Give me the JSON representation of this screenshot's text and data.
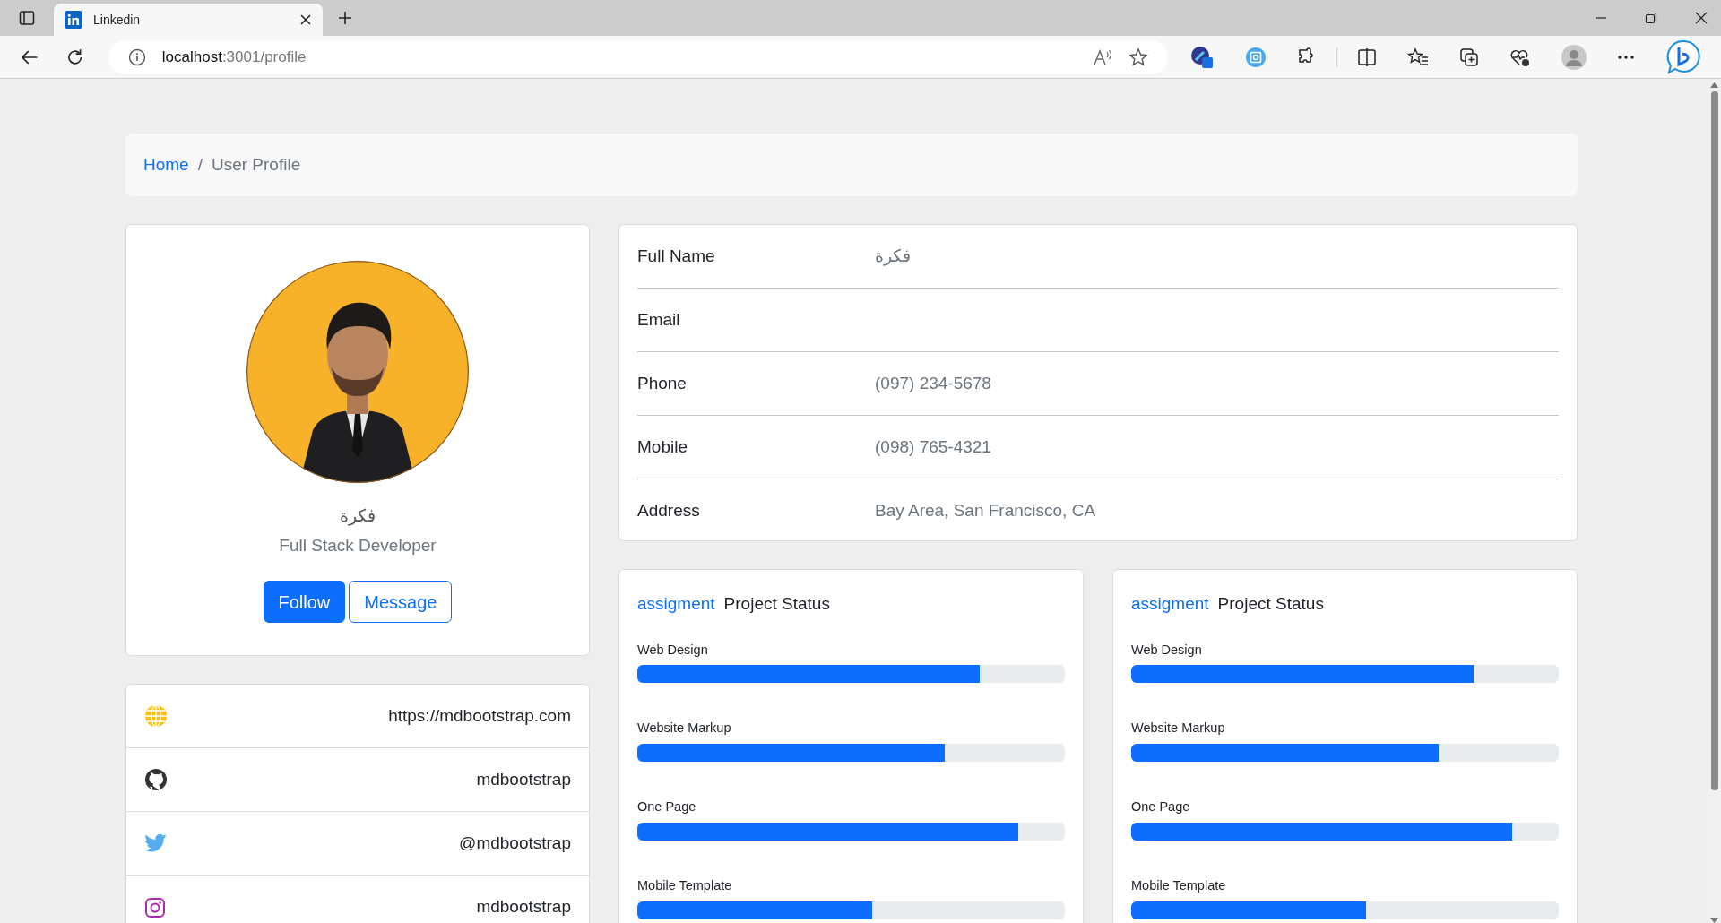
{
  "browser": {
    "tab_title": "Linkedin",
    "url_host": "localhost",
    "url_path": ":3001/profile"
  },
  "breadcrumb": {
    "separator": "/",
    "items": [
      {
        "label": "Home",
        "kind": "link"
      },
      {
        "label": "User Profile",
        "kind": "current"
      }
    ]
  },
  "profile": {
    "name": "فكرة",
    "title": "Full Stack Developer",
    "buttons": [
      {
        "label": "Follow",
        "kind": "primary"
      },
      {
        "label": "Message",
        "kind": "outline"
      }
    ]
  },
  "social": [
    {
      "kind": "globe",
      "text": "https://mdbootstrap.com"
    },
    {
      "kind": "github",
      "text": "mdbootstrap"
    },
    {
      "kind": "twitter",
      "text": "@mdbootstrap"
    },
    {
      "kind": "instagram",
      "text": "mdbootstrap"
    }
  ],
  "details": [
    {
      "label": "Full Name",
      "value": "فكرة"
    },
    {
      "label": "Email"
    },
    {
      "label": "Phone",
      "value": "(097) 234-5678"
    },
    {
      "label": "Mobile",
      "value": "(098) 765-4321"
    },
    {
      "label": "Address",
      "value": "Bay Area, San Francisco, CA"
    }
  ],
  "projects": [
    {
      "tag": "assigment",
      "title": "Project Status",
      "bars": [
        {
          "label": "Web Design",
          "level": 0.8
        },
        {
          "label": "Website Markup",
          "level": 0.72
        },
        {
          "label": "One Page",
          "level": 0.89
        },
        {
          "label": "Mobile Template",
          "level": 0.55
        }
      ]
    },
    {
      "tag": "assigment",
      "title": "Project Status",
      "bars": [
        {
          "label": "Web Design",
          "level": 0.8
        },
        {
          "label": "Website Markup",
          "level": 0.72
        },
        {
          "label": "One Page",
          "level": 0.89
        },
        {
          "label": "Mobile Template",
          "level": 0.55
        }
      ]
    }
  ]
}
